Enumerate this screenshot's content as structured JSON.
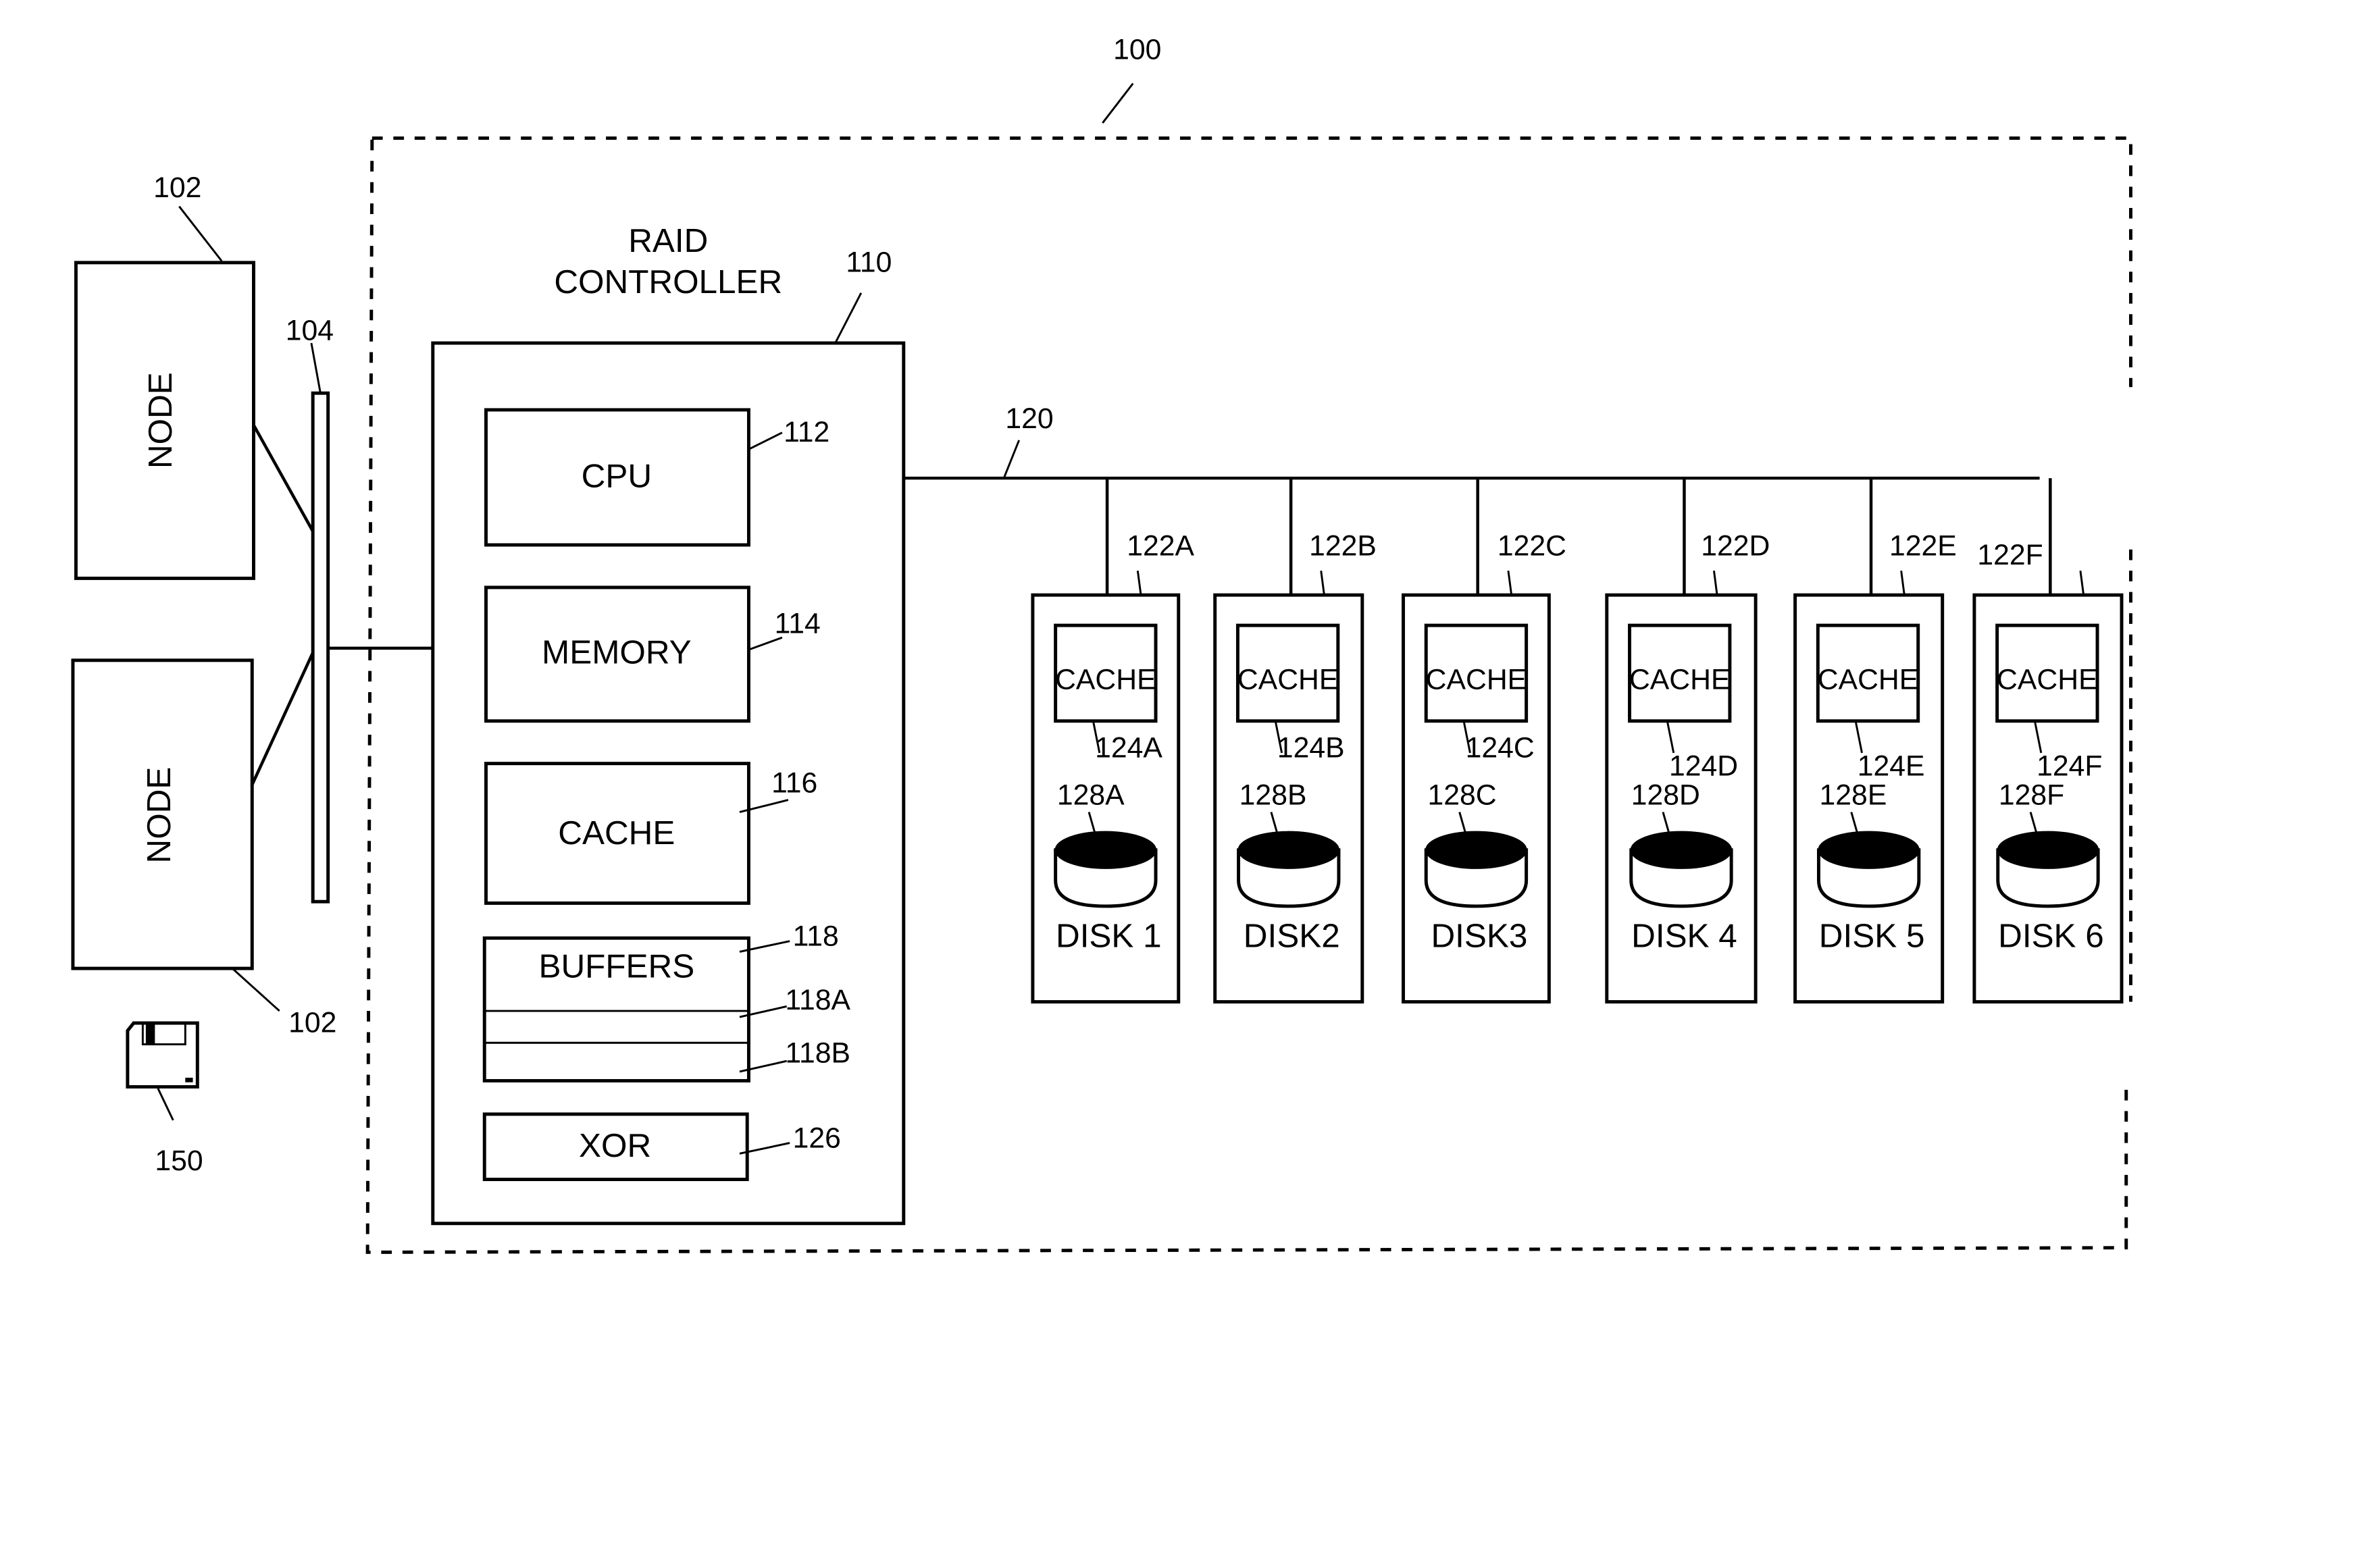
{
  "figure": {
    "system_ref": "100",
    "nodes": [
      {
        "label": "NODE",
        "ref": "102"
      },
      {
        "label": "NODE",
        "ref": "102"
      }
    ],
    "interconnect_ref": "104",
    "storage_media_ref": "150",
    "raid_controller": {
      "title_line1": "RAID",
      "title_line2": "CONTROLLER",
      "ref": "110",
      "components": [
        {
          "label": "CPU",
          "ref": "112"
        },
        {
          "label": "MEMORY",
          "ref": "114"
        },
        {
          "label": "CACHE",
          "ref": "116"
        },
        {
          "label": "BUFFERS",
          "ref": "118",
          "sub_refs": [
            "118A",
            "118B"
          ]
        },
        {
          "label": "XOR",
          "ref": "126"
        }
      ]
    },
    "bus_ref": "120",
    "disks": [
      {
        "label": "DISK 1",
        "link_ref": "122A",
        "cache_label": "CACHE",
        "cache_ref": "124A",
        "platter_ref": "128A"
      },
      {
        "label": "DISK2",
        "link_ref": "122B",
        "cache_label": "CACHE",
        "cache_ref": "124B",
        "platter_ref": "128B"
      },
      {
        "label": "DISK3",
        "link_ref": "122C",
        "cache_label": "CACHE",
        "cache_ref": "124C",
        "platter_ref": "128C"
      },
      {
        "label": "DISK 4",
        "link_ref": "122D",
        "cache_label": "CACHE",
        "cache_ref": "124D",
        "platter_ref": "128D"
      },
      {
        "label": "DISK 5",
        "link_ref": "122E",
        "cache_label": "CACHE",
        "cache_ref": "124E",
        "platter_ref": "128E"
      },
      {
        "label": "DISK 6",
        "link_ref": "122F",
        "cache_label": "CACHE",
        "cache_ref": "124F",
        "platter_ref": "128F"
      }
    ]
  }
}
